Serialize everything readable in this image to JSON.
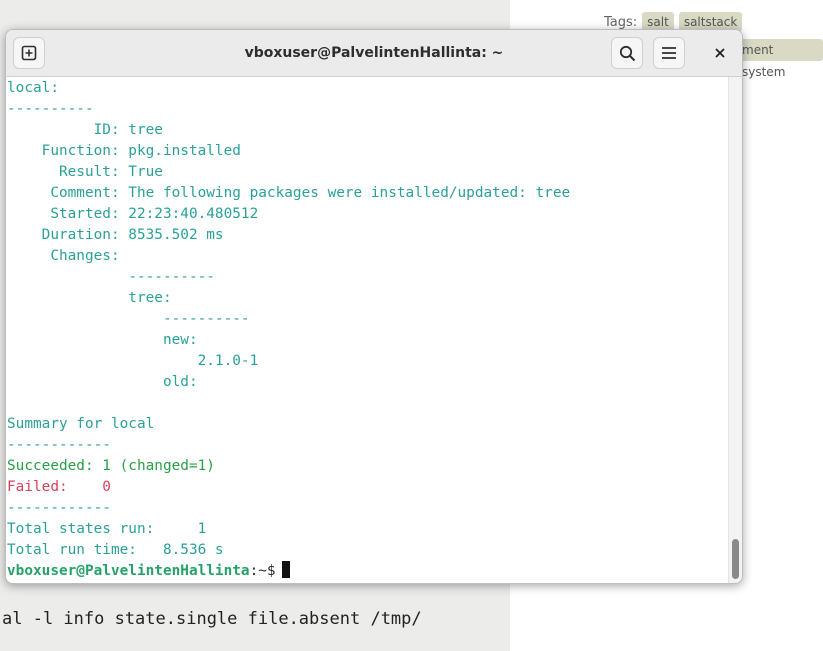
{
  "background": {
    "command_fragment": "al -l info state.single file.absent /tmp/",
    "tags_label": "Tags:",
    "tags": [
      "salt",
      "saltstack"
    ],
    "tag_partial": "ment system"
  },
  "window": {
    "title": "vboxuser@PalvelintenHallinta: ~",
    "new_tab_icon": "new-tab-icon",
    "search_icon": "search-icon",
    "menu_icon": "hamburger-menu-icon",
    "close_icon": "close-icon"
  },
  "terminal": {
    "lines": [
      {
        "cls": "",
        "text": "local:"
      },
      {
        "cls": "",
        "text": "----------"
      },
      {
        "cls": "",
        "text": "          ID: tree"
      },
      {
        "cls": "",
        "text": "    Function: pkg.installed"
      },
      {
        "cls": "",
        "text": "      Result: True"
      },
      {
        "cls": "",
        "text": "     Comment: The following packages were installed/updated: tree"
      },
      {
        "cls": "",
        "text": "     Started: 22:23:40.480512"
      },
      {
        "cls": "",
        "text": "    Duration: 8535.502 ms"
      },
      {
        "cls": "",
        "text": "     Changes:"
      },
      {
        "cls": "",
        "text": "              ----------"
      },
      {
        "cls": "",
        "text": "              tree:",
        "plain_suffix": true
      },
      {
        "cls": "",
        "text": "                  ----------"
      },
      {
        "cls": "",
        "text": "                  new:",
        "plain_suffix": true
      },
      {
        "cls": "",
        "text": "                      2.1.0-1"
      },
      {
        "cls": "",
        "text": "                  old:",
        "plain_suffix": true
      },
      {
        "cls": "",
        "text": ""
      },
      {
        "cls": "",
        "text": "Summary for local"
      },
      {
        "cls": "",
        "text": "------------"
      },
      {
        "cls": "green",
        "text": "Succeeded: 1 (changed=1)"
      },
      {
        "cls": "red",
        "text": "Failed:    0"
      },
      {
        "cls": "",
        "text": "------------"
      },
      {
        "cls": "",
        "text": "Total states run:     1"
      },
      {
        "cls": "",
        "text": "Total run time:   8.536 s"
      }
    ],
    "prompt_user": "vboxuser@PalvelintenHallinta",
    "prompt_path": ":~$"
  },
  "colors": {
    "output_cyan": "#2aa198",
    "success_green": "#27a046",
    "failed_red": "#d7415b",
    "prompt_green": "#26a269"
  }
}
